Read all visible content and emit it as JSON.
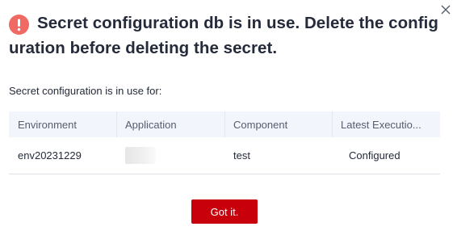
{
  "dialog": {
    "title": "Secret configuration db is in use. Delete the configuration before deleting the secret.",
    "subtitle": "Secret configuration is in use for:",
    "confirm_label": "Got it."
  },
  "table": {
    "columns": [
      "Environment",
      "Application",
      "Component",
      "Latest Executio..."
    ],
    "rows": [
      {
        "environment": "env20231229",
        "application": "",
        "component": "test",
        "status": "Configured"
      }
    ]
  },
  "colors": {
    "alert": "#ee6a62",
    "primary_button": "#c7000b",
    "table_header_bg": "#f2f5fc"
  },
  "icons": {
    "alert": "exclamation-circle-icon",
    "close": "close-icon"
  }
}
